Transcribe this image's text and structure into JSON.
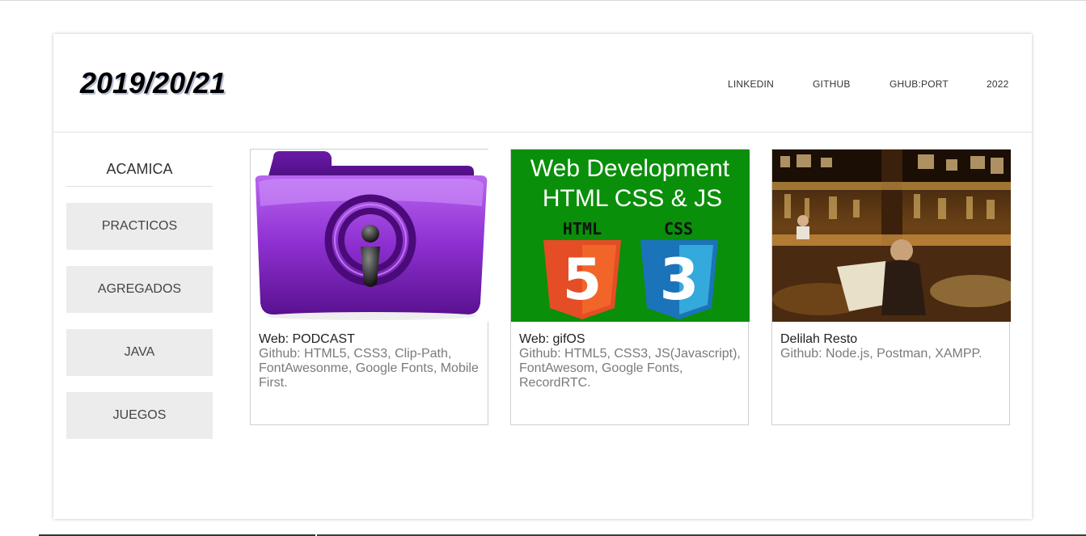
{
  "header": {
    "logo": "2019/20/21",
    "nav": [
      "LINKEDIN",
      "GITHUB",
      "GHUB:PORT",
      "2022"
    ]
  },
  "sidebar": {
    "title": "ACAMICA",
    "items": [
      "PRACTICOS",
      "AGREGADOS",
      "JAVA",
      "JUEGOS"
    ]
  },
  "cards": [
    {
      "title": "Web: PODCAST",
      "desc": "Github: HTML5, CSS3, Clip-Path, FontAwesonme, Google Fonts, Mobile First.",
      "image": "podcast-folder-icon"
    },
    {
      "title": "Web: gifOS",
      "desc": "Github: HTML5, CSS3, JS(Javascript), FontAwesom, Google Fonts, RecordRTC.",
      "image": "web-development-banner",
      "banner": {
        "line1": "Web Development",
        "line2": "HTML CSS & JS",
        "html_label": "HTML",
        "css_label": "CSS",
        "html_num": "5",
        "css_num": "3"
      }
    },
    {
      "title": "Delilah Resto",
      "desc": "Github: Node.js, Postman, XAMPP.",
      "image": "restaurant-photo"
    }
  ],
  "colors": {
    "banner_green": "#0a8f0a",
    "html5_orange": "#e44d26",
    "css3_blue": "#1b73ba",
    "folder_purple": "#8a2fc4"
  }
}
